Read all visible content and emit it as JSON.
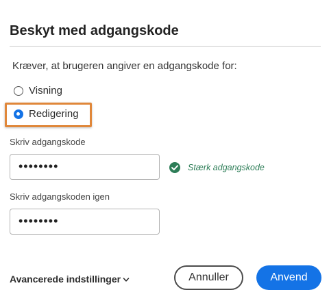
{
  "dialog": {
    "title": "Beskyt med adgangskode",
    "prompt": "Kræver, at brugeren angiver en adgangskode for:",
    "options": [
      {
        "label": "Visning",
        "selected": false
      },
      {
        "label": "Redigering",
        "selected": true
      }
    ],
    "password": {
      "label": "Skriv adgangskode",
      "value": "••••••••",
      "strength_text": "Stærk adgangskode"
    },
    "confirm": {
      "label": "Skriv adgangskoden igen",
      "value": "••••••••"
    },
    "advanced_label": "Avancerede indstillinger",
    "cancel_label": "Annuller",
    "apply_label": "Anvend"
  },
  "colors": {
    "accent": "#1473e6",
    "highlight": "#e0873a",
    "success": "#2d7d57"
  },
  "icons": {
    "strength": "check-circle-icon",
    "advanced": "chevron-down-icon"
  }
}
